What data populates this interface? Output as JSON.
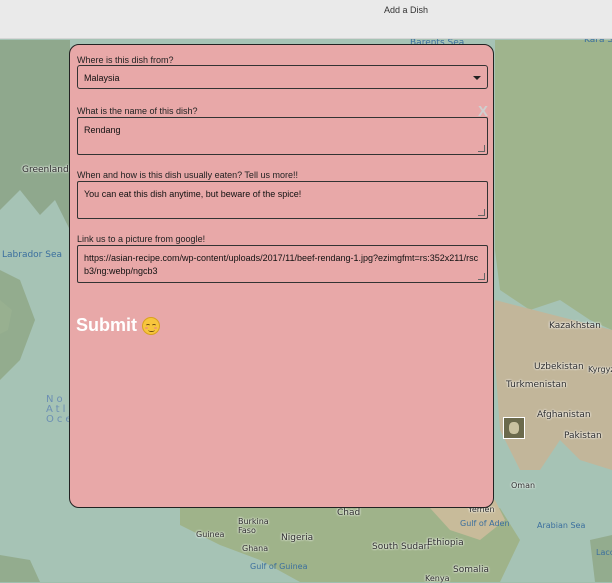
{
  "topbar": {
    "title": "Add a Dish"
  },
  "map": {
    "labels": {
      "barents_sea": "Barents Sea",
      "kara_sea": "Kara Se",
      "greenland": "Greenland",
      "labrador_sea": "Labrador Sea",
      "ocean": "No\nAtla\nOce",
      "kazakhstan": "Kazakhstan",
      "uzbekistan": "Uzbekistan",
      "kyrgyz": "Kyrgyz",
      "turkmenistan": "Turkmenistan",
      "afghanistan": "Afghanistan",
      "pakistan": "Pakistan",
      "oman": "Oman",
      "yemen": "Yemen",
      "gulf_of_aden": "Gulf of Aden",
      "arabian_sea": "Arabian Sea",
      "chad": "Chad",
      "burkina_faso": "Burkina\nFaso",
      "guinea": "Guinea",
      "ghana": "Ghana",
      "nigeria": "Nigeria",
      "south_sudan": "South Sudan",
      "ethiopia": "Ethiopia",
      "somalia": "Somalia",
      "gulf_of_guinea": "Gulf of Guinea",
      "kenya": "Kenya",
      "lacc": "Lacc"
    }
  },
  "form": {
    "close_label": "X",
    "origin": {
      "label": "Where is this dish from?",
      "value": "Malaysia"
    },
    "name": {
      "label": "What is the name of this dish?",
      "value": "Rendang"
    },
    "description": {
      "label": "When and how is this dish usually eaten? Tell us more!!",
      "value": "You can eat this dish anytime, but beware of the spice!"
    },
    "picture": {
      "label": "Link us to a picture from google!",
      "value": "https://asian-recipe.com/wp-content/uploads/2017/11/beef-rendang-1.jpg?ezimgfmt=rs:352x211/rscb3/ng:webp/ngcb3"
    },
    "submit_label": "Submit"
  },
  "colors": {
    "modal_bg": "#e8a8a8",
    "submit_text": "#ffffff",
    "topbar_bg": "#eaeaea"
  }
}
